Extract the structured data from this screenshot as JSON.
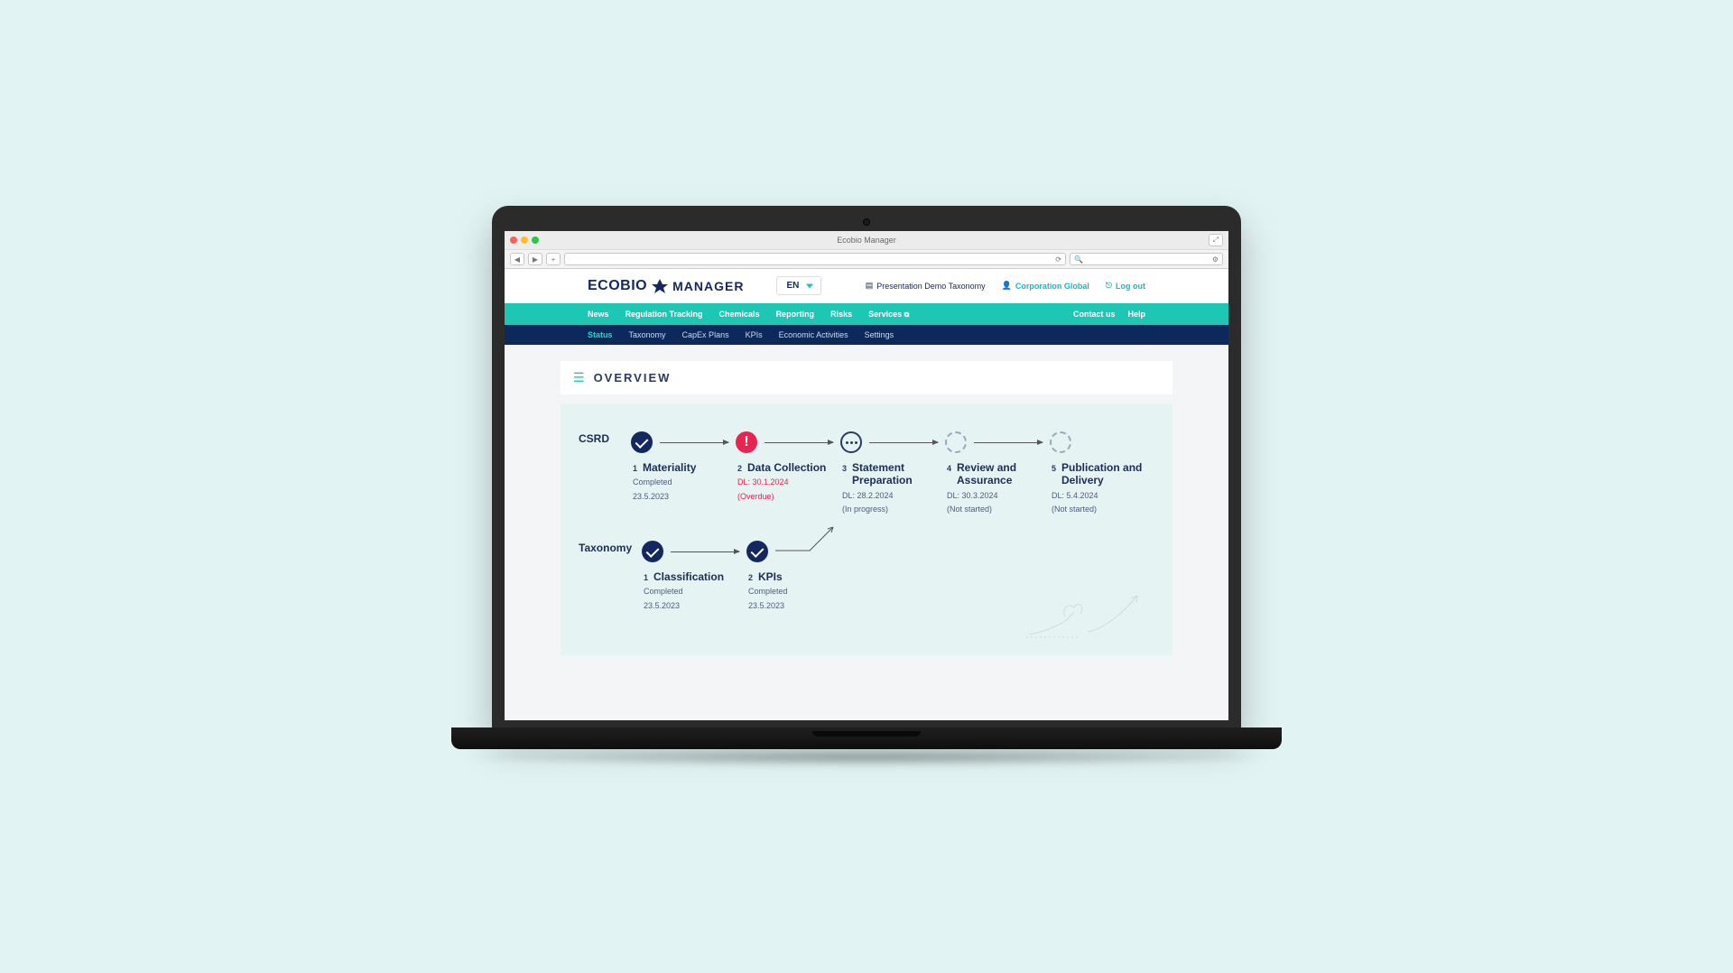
{
  "window": {
    "title": "Ecobio Manager"
  },
  "logo": {
    "brand": "ECOBIO",
    "suffix": "MANAGER"
  },
  "language": "EN",
  "header": {
    "demo": "Presentation Demo Taxonomy",
    "corp": "Corporation Global",
    "logout": "Log out"
  },
  "nav_primary": [
    "News",
    "Regulation Tracking",
    "Chemicals",
    "Reporting",
    "Risks",
    "Services"
  ],
  "nav_primary_right": [
    "Contact us",
    "Help"
  ],
  "nav_secondary": [
    "Status",
    "Taxonomy",
    "CapEx Plans",
    "KPIs",
    "Economic Activities",
    "Settings"
  ],
  "nav_secondary_active": "Status",
  "page_title": "OVERVIEW",
  "tracks": {
    "csrd": {
      "label": "CSRD",
      "steps": [
        {
          "num": "1",
          "title": "Materiality",
          "line1": "Completed",
          "line2": "23.5.2023",
          "state": "done"
        },
        {
          "num": "2",
          "title": "Data Collection",
          "line1": "DL: 30.1.2024",
          "line2": "(Overdue)",
          "state": "warn"
        },
        {
          "num": "3",
          "title": "Statement Preparation",
          "line1": "DL: 28.2.2024",
          "line2": "(In progress)",
          "state": "prog"
        },
        {
          "num": "4",
          "title": "Review and Assurance",
          "line1": "DL: 30.3.2024",
          "line2": "(Not started)",
          "state": "dash"
        },
        {
          "num": "5",
          "title": "Publication and Delivery",
          "line1": "DL: 5.4.2024",
          "line2": "(Not started)",
          "state": "dash"
        }
      ]
    },
    "taxonomy": {
      "label": "Taxonomy",
      "steps": [
        {
          "num": "1",
          "title": "Classification",
          "line1": "Completed",
          "line2": "23.5.2023",
          "state": "done"
        },
        {
          "num": "2",
          "title": "KPIs",
          "line1": "Completed",
          "line2": "23.5.2023",
          "state": "done"
        }
      ]
    }
  }
}
